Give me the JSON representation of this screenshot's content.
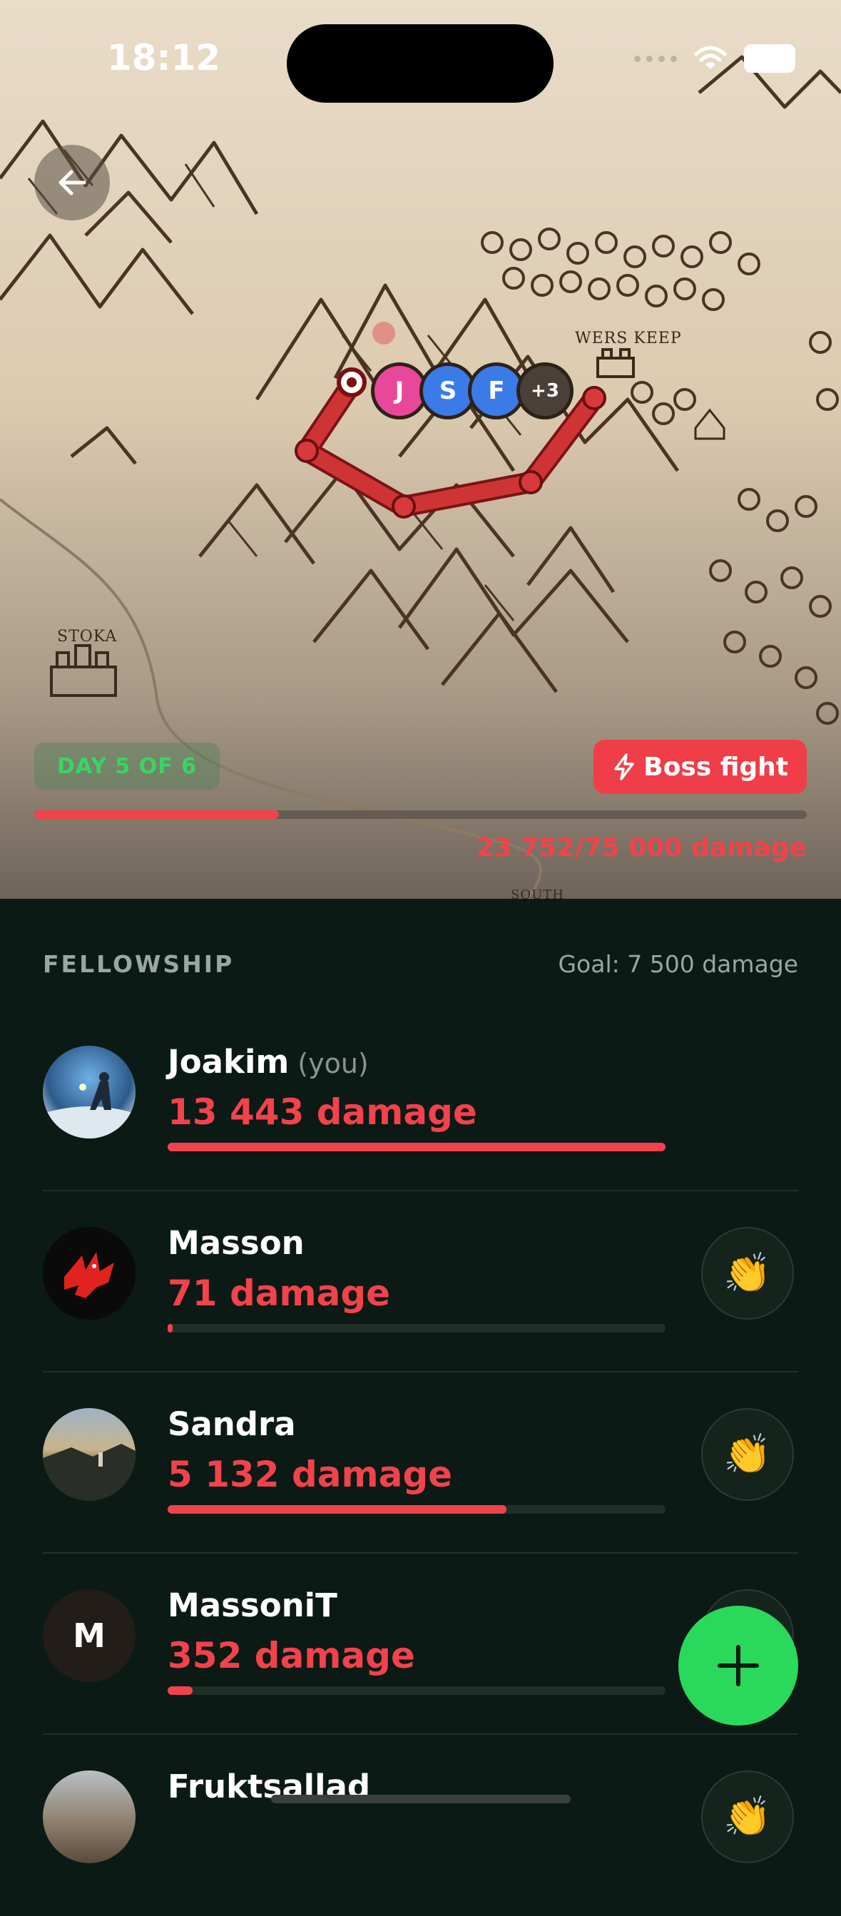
{
  "status_bar": {
    "time": "18:12"
  },
  "map": {
    "places": [
      "WERS KEEP",
      "STOKA",
      "SOUTH"
    ],
    "route_avatars": [
      {
        "initial": "J",
        "color": "#e9479a"
      },
      {
        "initial": "S",
        "color": "#3b7be8"
      },
      {
        "initial": "F",
        "color": "#3b7be8"
      },
      {
        "initial": "+3",
        "color": "#4a4038"
      }
    ],
    "day_label": "DAY 5 OF 6",
    "boss_label": "Boss fight",
    "progress_text": "23 752/75 000 damage",
    "progress_value": 23752,
    "progress_max": 75000
  },
  "fellowship": {
    "title": "FELLOWSHIP",
    "goal": "Goal: 7 500 damage",
    "members": [
      {
        "name": "Joakim",
        "you": "(you)",
        "damage": "13 443 damage",
        "progress": 1.0
      },
      {
        "name": "Masson",
        "damage": "71 damage",
        "progress": 0.01
      },
      {
        "name": "Sandra",
        "damage": "5 132 damage",
        "progress": 0.68
      },
      {
        "name": "MassoniT",
        "initial": "M",
        "damage": "352 damage",
        "progress": 0.05
      },
      {
        "name": "Fruktsallad"
      }
    ]
  },
  "colors": {
    "accent": "#f2424b",
    "green": "#2ad95c",
    "bg": "#0b1a14"
  }
}
